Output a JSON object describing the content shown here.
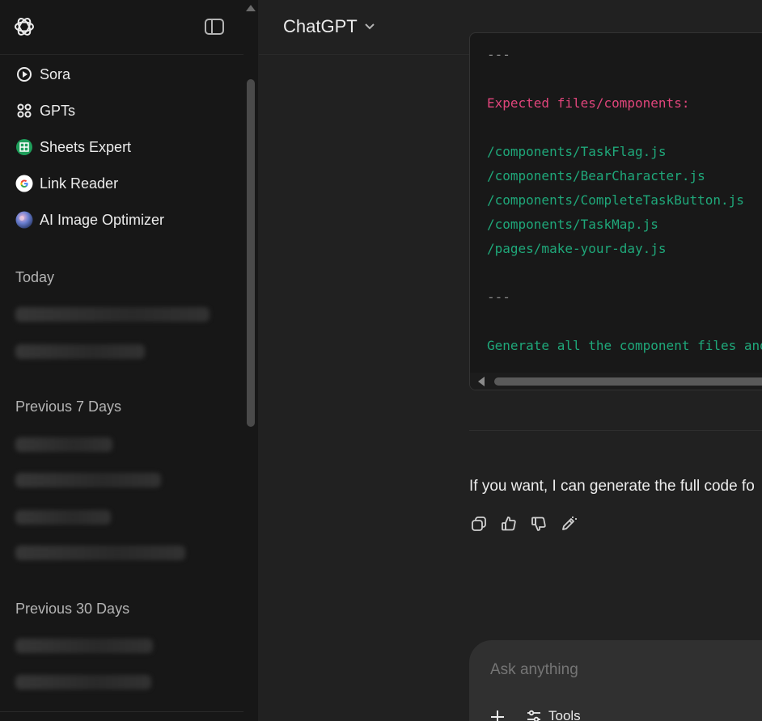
{
  "sidebar": {
    "items": [
      {
        "label": "Sora",
        "icon": "sora-icon"
      },
      {
        "label": "GPTs",
        "icon": "gpts-grid-icon"
      },
      {
        "label": "Sheets Expert",
        "icon": "sheets-expert-icon"
      },
      {
        "label": "Link Reader",
        "icon": "google-icon"
      },
      {
        "label": "AI Image Optimizer",
        "icon": "image-optimizer-icon"
      }
    ],
    "sections": {
      "today": "Today",
      "prev7": "Previous 7 Days",
      "prev30": "Previous 30 Days"
    }
  },
  "header": {
    "model": "ChatGPT"
  },
  "code": {
    "lines": [
      {
        "text": "---",
        "style": "grey"
      },
      {
        "text": "Expected files/components:",
        "style": "pink"
      },
      {
        "text": "/components/TaskFlag.js",
        "style": "green"
      },
      {
        "text": "/components/BearCharacter.js",
        "style": "green"
      },
      {
        "text": "/components/CompleteTaskButton.js",
        "style": "green"
      },
      {
        "text": "/components/TaskMap.js",
        "style": "green"
      },
      {
        "text": "/pages/make-your-day.js",
        "style": "green"
      },
      {
        "text": "---",
        "style": "grey"
      },
      {
        "text": "Generate all the component files and",
        "style": "green"
      }
    ]
  },
  "message": {
    "text": "If you want, I can generate the full code fo"
  },
  "composer": {
    "placeholder": "Ask anything",
    "tools_label": "Tools"
  },
  "colors": {
    "sidebar_bg": "#171717",
    "main_bg": "#212121",
    "code_pink": "#e0457b",
    "code_green": "#1fa87a"
  }
}
